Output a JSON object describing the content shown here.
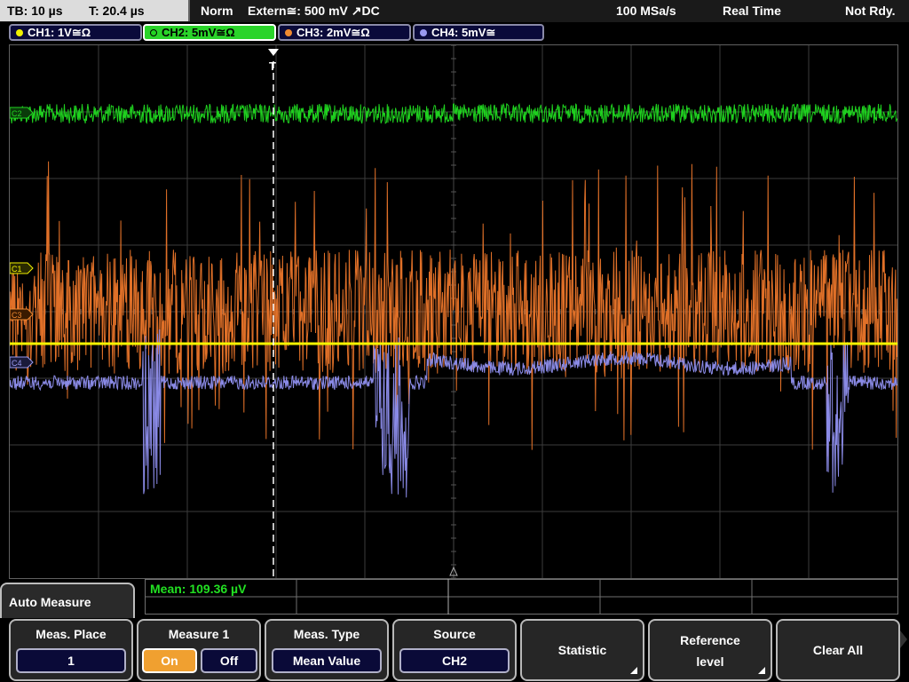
{
  "topbar": {
    "timebase": "TB: 10 µs",
    "trigger_time": "T: 20.4 µs",
    "mode": "Norm",
    "trigger": "Extern≅: 500 mV ↗DC",
    "sample_rate": "100 MSa/s",
    "acq_mode": "Real Time",
    "status": "Not Rdy."
  },
  "channels": [
    {
      "label": "CH1: 1V≅Ω",
      "color": "#f0f000",
      "active": false
    },
    {
      "label": "CH2: 5mV≅Ω",
      "color": "#22d422",
      "active": true
    },
    {
      "label": "CH3: 2mV≅Ω",
      "color": "#f08a30",
      "active": false
    },
    {
      "label": "CH4: 5mV≅",
      "color": "#9a9af0",
      "active": false
    }
  ],
  "markers": {
    "c2": "C2",
    "c1": "C1",
    "c3": "C3",
    "c4": "C4",
    "trigger": "T"
  },
  "trace_colors": {
    "ch1": "#f5f500",
    "ch2": "#1fd01f",
    "ch3": "#e07028",
    "ch4": "#8a8ae6",
    "grid": "#3c3c3c"
  },
  "measurement": {
    "readout": "Mean: 109.36 µV"
  },
  "menu": {
    "title": "Auto Measure",
    "softkeys": {
      "meas_place": {
        "label": "Meas. Place",
        "value": "1"
      },
      "measure1": {
        "label": "Measure 1",
        "on": "On",
        "off": "Off"
      },
      "meas_type": {
        "label": "Meas. Type",
        "value": "Mean Value"
      },
      "source": {
        "label": "Source",
        "value": "CH2"
      },
      "statistic": {
        "label": "Statistic"
      },
      "reference_level": {
        "label1": "Reference",
        "label2": "level"
      },
      "clear_all": {
        "label": "Clear All"
      }
    }
  }
}
